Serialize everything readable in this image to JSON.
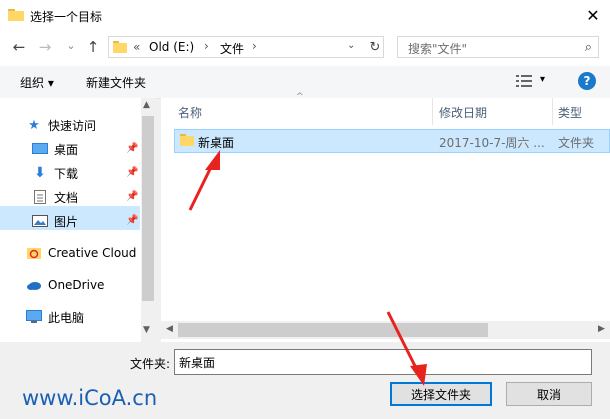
{
  "window": {
    "title": "选择一个目标",
    "close_symbol": "✕"
  },
  "nav": {
    "back_symbol": "←",
    "forward_symbol": "→",
    "recent_symbol": "⌄",
    "up_symbol": "↑",
    "address": {
      "overflow": "«",
      "drive": "Old (E:)",
      "folder": "文件",
      "separator": "›",
      "dropdown": "⌄",
      "refresh": "↻"
    },
    "search": {
      "placeholder": "搜索\"文件\"",
      "icon": "⌕"
    }
  },
  "toolbar": {
    "organize": "组织 ▾",
    "new_folder": "新建文件夹",
    "view_dropdown": "▾",
    "help": "?"
  },
  "sidebar": {
    "quick_access": "快速访问",
    "items": [
      {
        "label": "桌面",
        "icon": "desktop-icon"
      },
      {
        "label": "下载",
        "icon": "download-icon"
      },
      {
        "label": "文档",
        "icon": "document-icon"
      },
      {
        "label": "图片",
        "icon": "pictures-icon"
      }
    ],
    "pin_symbol": "📌",
    "creative_cloud": "Creative Cloud F",
    "onedrive": "OneDrive",
    "this_pc": "此电脑",
    "scroll_up": "▲",
    "scroll_down": "▼"
  },
  "files": {
    "columns": {
      "name": "名称",
      "modified": "修改日期",
      "type": "类型"
    },
    "sort_indicator": "^",
    "rows": [
      {
        "name": "新桌面",
        "modified": "2017-10-7-周六 ...",
        "type": "文件夹"
      }
    ],
    "scroll_left": "◀",
    "scroll_right": "▶"
  },
  "footer": {
    "folder_label": "文件夹:",
    "folder_value": "新桌面",
    "select_button": "选择文件夹",
    "cancel_button": "取消"
  },
  "watermark": "www.iCoA.cn",
  "colors": {
    "selection": "#cce8ff",
    "accent": "#0078d7",
    "arrow": "#e8231e",
    "watermark": "#1a5fb4"
  }
}
